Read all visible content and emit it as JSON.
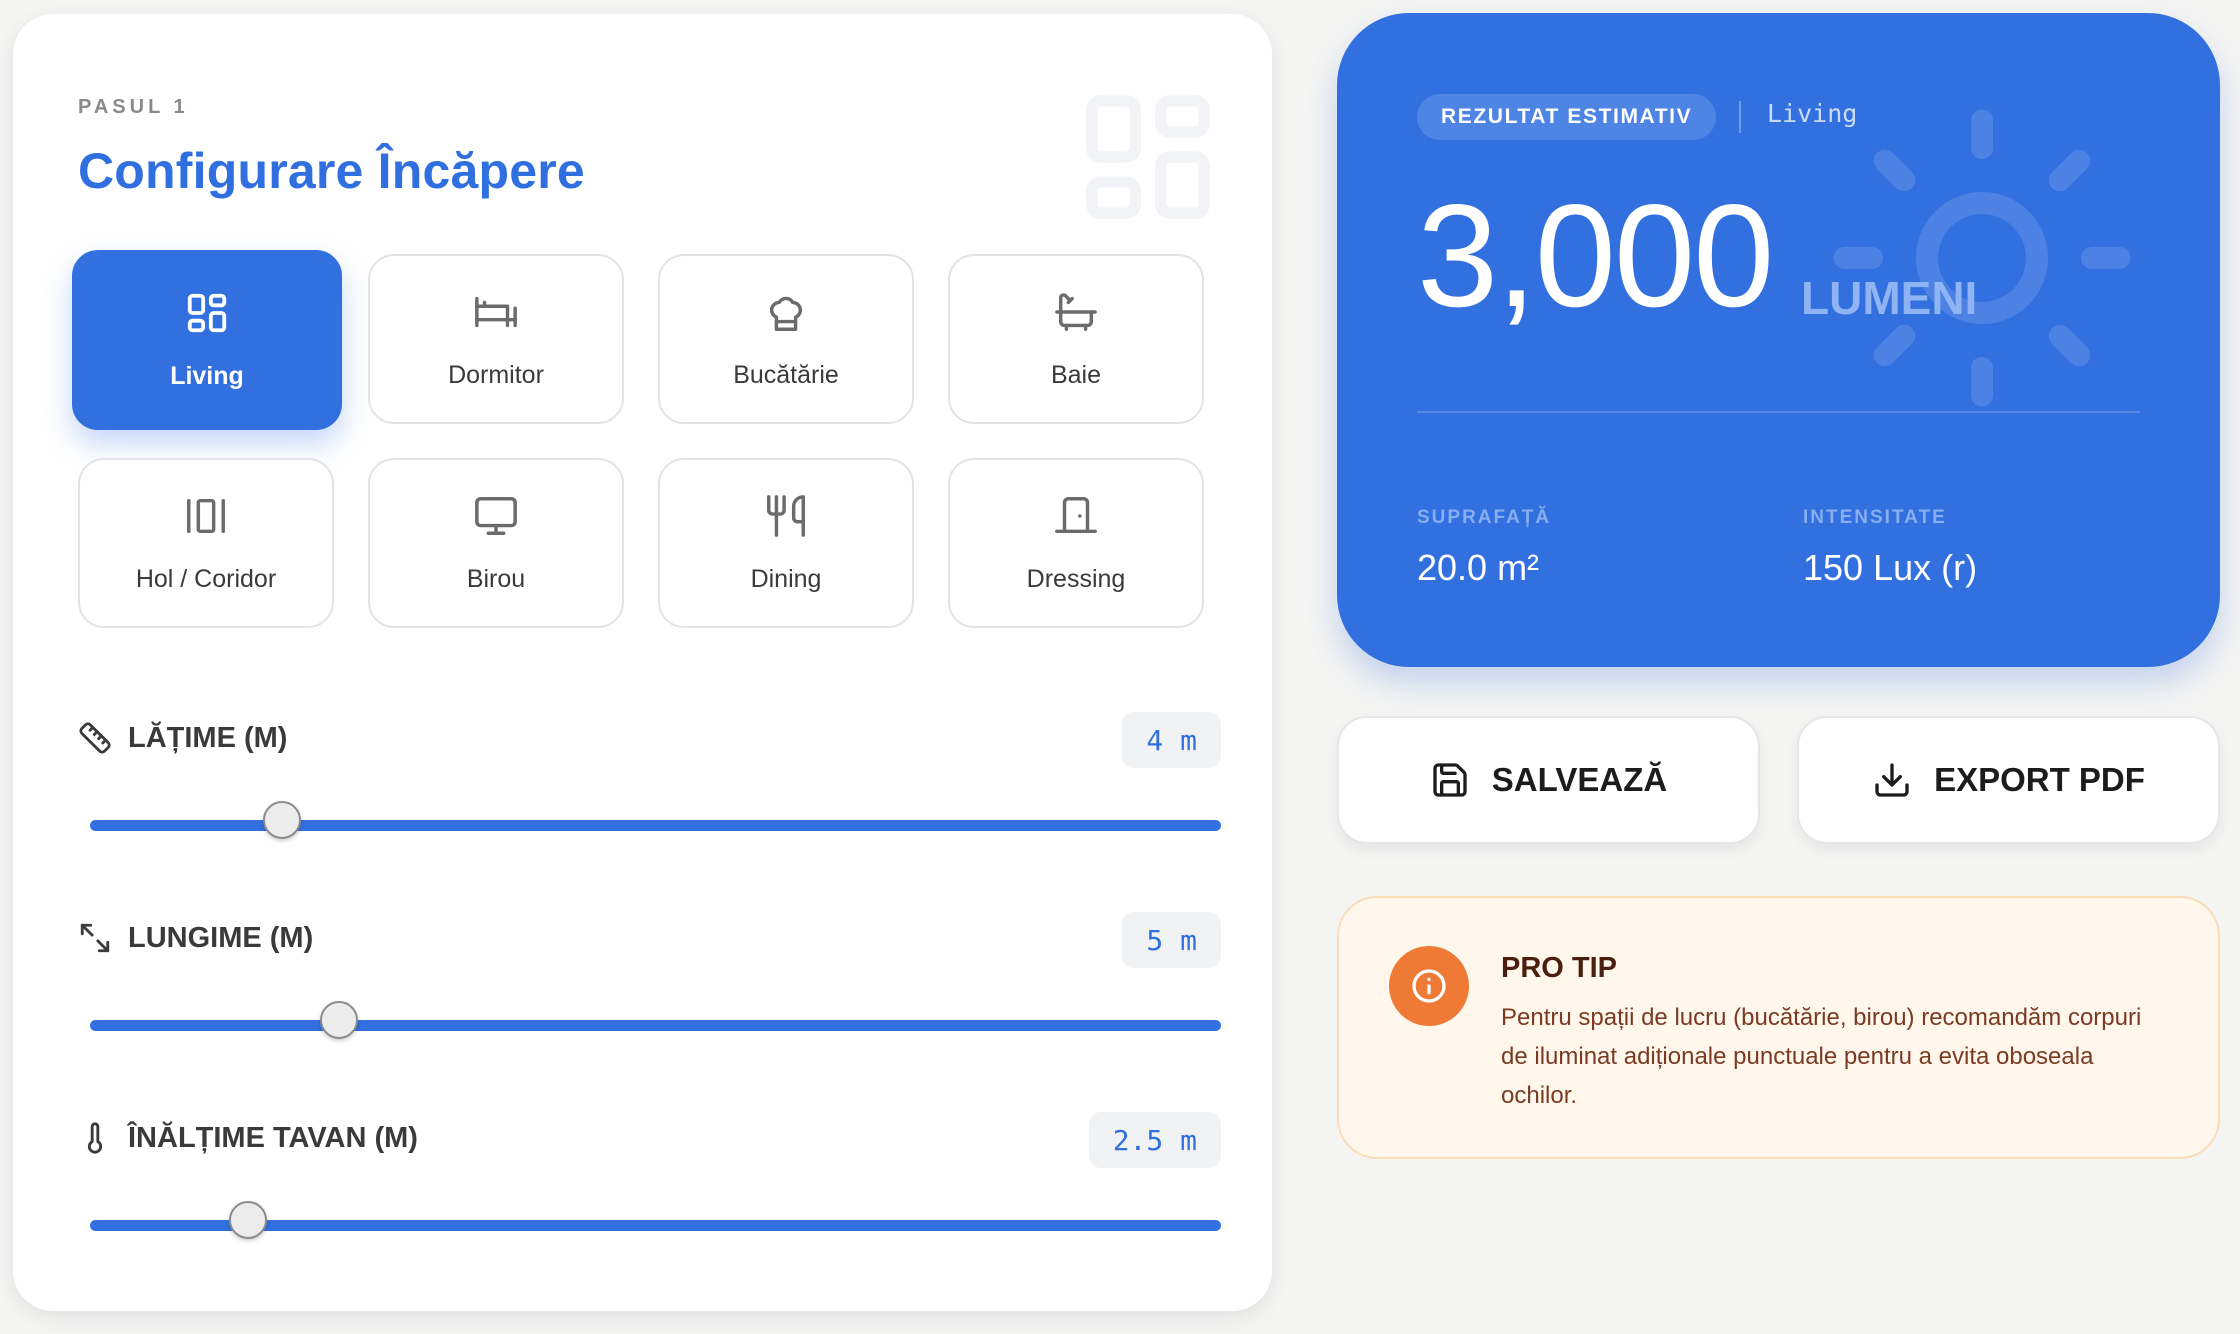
{
  "config": {
    "step_label": "PASUL 1",
    "title": "Configurare Încăpere",
    "rooms": [
      {
        "label": "Living",
        "icon": "grid-icon",
        "active": true
      },
      {
        "label": "Dormitor",
        "icon": "bed-icon",
        "active": false
      },
      {
        "label": "Bucătărie",
        "icon": "chef-hat-icon",
        "active": false
      },
      {
        "label": "Baie",
        "icon": "bath-icon",
        "active": false
      },
      {
        "label": "Hol / Coridor",
        "icon": "hallway-icon",
        "active": false
      },
      {
        "label": "Birou",
        "icon": "monitor-icon",
        "active": false
      },
      {
        "label": "Dining",
        "icon": "utensils-icon",
        "active": false
      },
      {
        "label": "Dressing",
        "icon": "door-icon",
        "active": false
      }
    ],
    "sliders": {
      "width": {
        "label": "LĂȚIME (M)",
        "value_text": "4 m",
        "value": 4,
        "fill": 0.17,
        "icon": "ruler-icon"
      },
      "length": {
        "label": "LUNGIME (M)",
        "value_text": "5 m",
        "value": 5,
        "fill": 0.22,
        "icon": "expand-icon"
      },
      "height": {
        "label": "ÎNĂLȚIME TAVAN (M)",
        "value_text": "2.5 m",
        "value": 2.5,
        "fill": 0.14,
        "icon": "thermometer-icon"
      }
    }
  },
  "result": {
    "badge": "REZULTAT ESTIMATIV",
    "room": "Living",
    "value": "3,000",
    "unit": "LUMENI",
    "area_label": "SUPRAFAȚĂ",
    "area_value": "20.0 m²",
    "intensity_label": "INTENSITATE",
    "intensity_value": "150 Lux (r)"
  },
  "actions": {
    "save_label": "SALVEAZĂ",
    "export_label": "EXPORT PDF"
  },
  "tip": {
    "title": "PRO TIP",
    "text": "Pentru spații de lucru (bucătărie, birou) recomandăm corpuri de iluminat adiționale punctuale pentru a evita oboseala ochilor."
  },
  "colors": {
    "accent": "#3270e0",
    "tip_accent": "#ee7a35",
    "background": "#f4f4f3"
  }
}
